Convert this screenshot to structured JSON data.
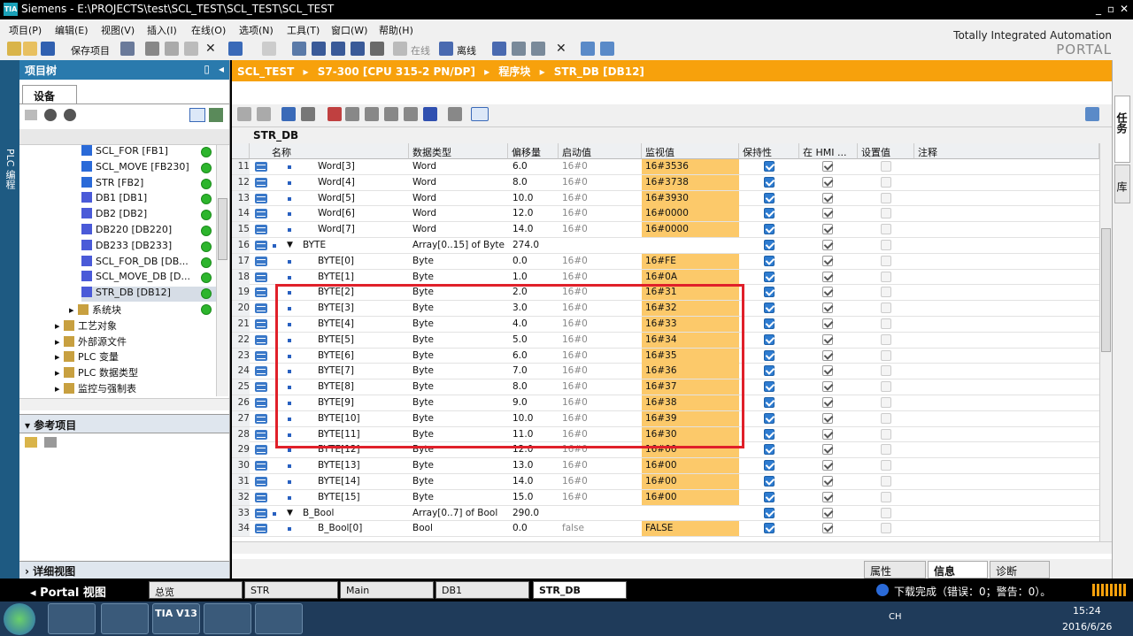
{
  "window": {
    "title": "Siemens  -  E:\\PROJECTS\\test\\SCL_TEST\\SCL_TEST\\SCL_TEST",
    "minimize": "_",
    "restore": "▫",
    "close": "✕"
  },
  "menu": [
    "项目(P)",
    "编辑(E)",
    "视图(V)",
    "插入(I)",
    "在线(O)",
    "选项(N)",
    "工具(T)",
    "窗口(W)",
    "帮助(H)"
  ],
  "toolbar": {
    "save_label": "保存项目",
    "online_label": "在线",
    "offline_label": "离线"
  },
  "brand": {
    "line1": "Totally Integrated Automation",
    "line2": "PORTAL"
  },
  "left_strip": {
    "label": "PLC 编程"
  },
  "project_tree": {
    "title": "项目树",
    "tab": "设备",
    "items": [
      {
        "label": "SCL_FOR [FB1]",
        "indent": 3,
        "icon": "fb"
      },
      {
        "label": "SCL_MOVE [FB230]",
        "indent": 3,
        "icon": "fb"
      },
      {
        "label": "STR [FB2]",
        "indent": 3,
        "icon": "fb"
      },
      {
        "label": "DB1 [DB1]",
        "indent": 3,
        "icon": "db"
      },
      {
        "label": "DB2 [DB2]",
        "indent": 3,
        "icon": "db"
      },
      {
        "label": "DB220 [DB220]",
        "indent": 3,
        "icon": "db"
      },
      {
        "label": "DB233 [DB233]",
        "indent": 3,
        "icon": "db"
      },
      {
        "label": "SCL_FOR_DB [DB...",
        "indent": 3,
        "icon": "db"
      },
      {
        "label": "SCL_MOVE_DB [D...",
        "indent": 3,
        "icon": "db"
      },
      {
        "label": "STR_DB [DB12]",
        "indent": 3,
        "icon": "db"
      },
      {
        "label": "系统块",
        "indent": 2,
        "icon": "folder"
      },
      {
        "label": "工艺对象",
        "indent": 1,
        "icon": "folder"
      },
      {
        "label": "外部源文件",
        "indent": 1,
        "icon": "folder"
      },
      {
        "label": "PLC 变量",
        "indent": 1,
        "icon": "folder"
      },
      {
        "label": "PLC 数据类型",
        "indent": 1,
        "icon": "folder"
      },
      {
        "label": "监控与强制表",
        "indent": 1,
        "icon": "folder"
      }
    ],
    "reference_title": "参考项目",
    "detail_title": "详细视图"
  },
  "breadcrumb": [
    "SCL_TEST",
    "S7-300 [CPU 315-2 PN/DP]",
    "程序块",
    "STR_DB [DB12]"
  ],
  "block_name": "STR_DB",
  "columns": [
    "名称",
    "数据类型",
    "偏移量",
    "启动值",
    "监视值",
    "保持性",
    "在 HMI ...",
    "设置值",
    "注释"
  ],
  "rows": [
    {
      "n": "11",
      "name": "Word[3]",
      "type": "Word",
      "offset": "6.0",
      "start": "16#0",
      "monitor": "16#3536",
      "lvl": 2
    },
    {
      "n": "12",
      "name": "Word[4]",
      "type": "Word",
      "offset": "8.0",
      "start": "16#0",
      "monitor": "16#3738",
      "lvl": 2
    },
    {
      "n": "13",
      "name": "Word[5]",
      "type": "Word",
      "offset": "10.0",
      "start": "16#0",
      "monitor": "16#3930",
      "lvl": 2
    },
    {
      "n": "14",
      "name": "Word[6]",
      "type": "Word",
      "offset": "12.0",
      "start": "16#0",
      "monitor": "16#0000",
      "lvl": 2
    },
    {
      "n": "15",
      "name": "Word[7]",
      "type": "Word",
      "offset": "14.0",
      "start": "16#0",
      "monitor": "16#0000",
      "lvl": 2
    },
    {
      "n": "16",
      "name": "BYTE",
      "type": "Array[0..15] of Byte",
      "offset": "274.0",
      "start": "",
      "monitor": "",
      "lvl": 1
    },
    {
      "n": "17",
      "name": "BYTE[0]",
      "type": "Byte",
      "offset": "0.0",
      "start": "16#0",
      "monitor": "16#FE",
      "lvl": 2
    },
    {
      "n": "18",
      "name": "BYTE[1]",
      "type": "Byte",
      "offset": "1.0",
      "start": "16#0",
      "monitor": "16#0A",
      "lvl": 2
    },
    {
      "n": "19",
      "name": "BYTE[2]",
      "type": "Byte",
      "offset": "2.0",
      "start": "16#0",
      "monitor": "16#31",
      "lvl": 2
    },
    {
      "n": "20",
      "name": "BYTE[3]",
      "type": "Byte",
      "offset": "3.0",
      "start": "16#0",
      "monitor": "16#32",
      "lvl": 2
    },
    {
      "n": "21",
      "name": "BYTE[4]",
      "type": "Byte",
      "offset": "4.0",
      "start": "16#0",
      "monitor": "16#33",
      "lvl": 2
    },
    {
      "n": "22",
      "name": "BYTE[5]",
      "type": "Byte",
      "offset": "5.0",
      "start": "16#0",
      "monitor": "16#34",
      "lvl": 2
    },
    {
      "n": "23",
      "name": "BYTE[6]",
      "type": "Byte",
      "offset": "6.0",
      "start": "16#0",
      "monitor": "16#35",
      "lvl": 2
    },
    {
      "n": "24",
      "name": "BYTE[7]",
      "type": "Byte",
      "offset": "7.0",
      "start": "16#0",
      "monitor": "16#36",
      "lvl": 2
    },
    {
      "n": "25",
      "name": "BYTE[8]",
      "type": "Byte",
      "offset": "8.0",
      "start": "16#0",
      "monitor": "16#37",
      "lvl": 2
    },
    {
      "n": "26",
      "name": "BYTE[9]",
      "type": "Byte",
      "offset": "9.0",
      "start": "16#0",
      "monitor": "16#38",
      "lvl": 2
    },
    {
      "n": "27",
      "name": "BYTE[10]",
      "type": "Byte",
      "offset": "10.0",
      "start": "16#0",
      "monitor": "16#39",
      "lvl": 2
    },
    {
      "n": "28",
      "name": "BYTE[11]",
      "type": "Byte",
      "offset": "11.0",
      "start": "16#0",
      "monitor": "16#30",
      "lvl": 2
    },
    {
      "n": "29",
      "name": "BYTE[12]",
      "type": "Byte",
      "offset": "12.0",
      "start": "16#0",
      "monitor": "16#00",
      "lvl": 2
    },
    {
      "n": "30",
      "name": "BYTE[13]",
      "type": "Byte",
      "offset": "13.0",
      "start": "16#0",
      "monitor": "16#00",
      "lvl": 2
    },
    {
      "n": "31",
      "name": "BYTE[14]",
      "type": "Byte",
      "offset": "14.0",
      "start": "16#0",
      "monitor": "16#00",
      "lvl": 2
    },
    {
      "n": "32",
      "name": "BYTE[15]",
      "type": "Byte",
      "offset": "15.0",
      "start": "16#0",
      "monitor": "16#00",
      "lvl": 2
    },
    {
      "n": "33",
      "name": "B_Bool",
      "type": "Array[0..7] of Bool",
      "offset": "290.0",
      "start": "",
      "monitor": "",
      "lvl": 1
    },
    {
      "n": "34",
      "name": "B_Bool[0]",
      "type": "Bool",
      "offset": "0.0",
      "start": "false",
      "monitor": "FALSE",
      "lvl": 2
    }
  ],
  "inspector_tabs": [
    "属性",
    "信息",
    "诊断"
  ],
  "portal_bar": {
    "portal_view": "Portal 视图",
    "tabs": [
      "总览",
      "STR",
      "Main",
      "DB1",
      "STR_DB"
    ],
    "status": "下载完成（错误：0；警告：0）。"
  },
  "right_strip": {
    "tasks": "任务",
    "libraries": "库"
  },
  "taskbar": {
    "ime": "CH",
    "time": "15:24",
    "date": "2016/6/26",
    "tia": "TIA V13"
  },
  "colors": {
    "accent": "#f7a10c",
    "monitor_bg": "#fcc96a",
    "tree_header": "#2a7aad",
    "highlight_box": "#e0202a"
  }
}
